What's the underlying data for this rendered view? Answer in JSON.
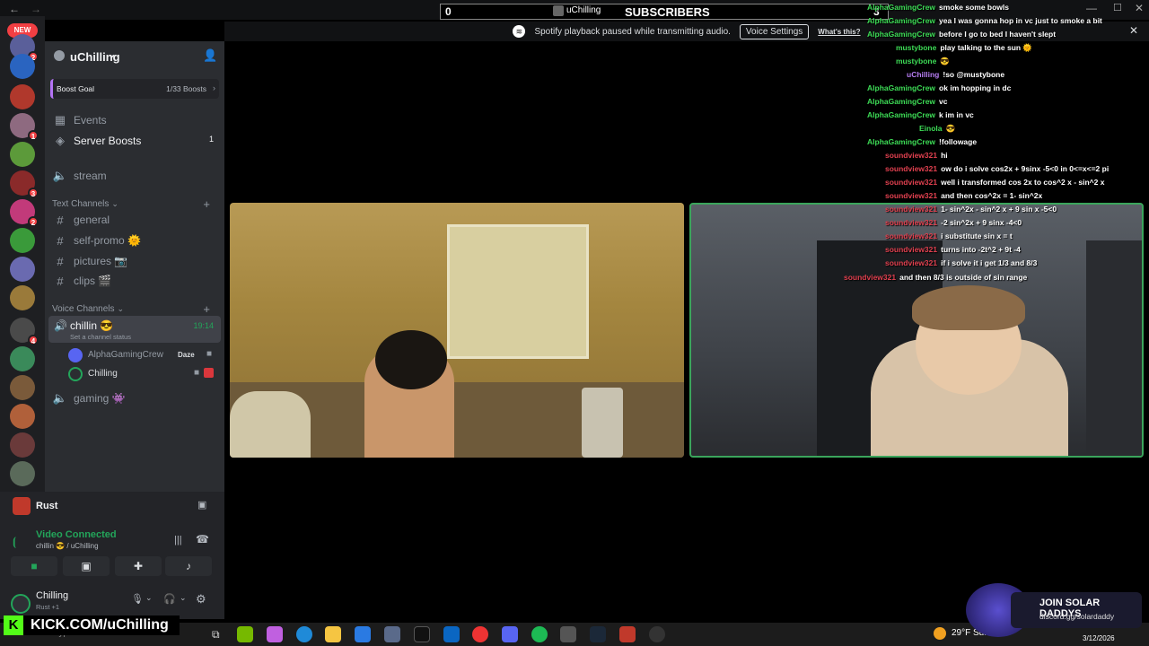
{
  "overlay": {
    "sub_count": "0",
    "sub_user": "uChilling",
    "sub_label": "SUBSCRIBERS",
    "sub_goal": "3"
  },
  "spotify_bar": {
    "message": "Spotify playback paused while transmitting audio.",
    "voice_settings": "Voice Settings",
    "whats_this": "What's this?"
  },
  "rail": {
    "new_label": "NEW",
    "badges": [
      "2",
      "1",
      "3",
      "2",
      "4"
    ]
  },
  "guild": {
    "name": "uChilling",
    "boost_goal_label": "Boost Goal",
    "boost_goal_value": "1/33 Boosts",
    "events": "Events",
    "server_boosts": "Server Boosts",
    "server_boosts_badge": "1",
    "stream": "stream",
    "text_channels_label": "Text Channels",
    "text_channels": [
      "general",
      "self-promo 🌞",
      "pictures 📷",
      "clips 🎬"
    ],
    "voice_channels_label": "Voice Channels",
    "voice_channel": "chillin 😎",
    "voice_timer": "19:14",
    "voice_status": "Set a channel status",
    "voice_members": [
      {
        "name": "AlphaGamingCrew",
        "tag": "Daze"
      },
      {
        "name": "Chilling",
        "tag": ""
      }
    ],
    "gaming_channel": "gaming 👾"
  },
  "activity": {
    "game": "Rust"
  },
  "connection": {
    "status": "Video Connected",
    "location": "chillin 😎 / uChilling"
  },
  "user": {
    "name": "Chilling",
    "sub": "Rust +1"
  },
  "chat": [
    {
      "user": "AlphaGamingCrew",
      "text": "smoke some bowls",
      "color": "#3ddc56"
    },
    {
      "user": "AlphaGamingCrew",
      "text": "yea I was gonna hop in vc just to smoke a bit",
      "color": "#3ddc56"
    },
    {
      "user": "AlphaGamingCrew",
      "text": "before I go to bed I haven't slept",
      "color": "#3ddc56"
    },
    {
      "user": "mustybone",
      "text": "play talking to the sun 🌞",
      "color": "#3ddc56"
    },
    {
      "user": "mustybone",
      "text": "😎",
      "color": "#3ddc56"
    },
    {
      "user": "uChilling",
      "text": "!so @mustybone",
      "color": "#b57cf0"
    },
    {
      "user": "AlphaGamingCrew",
      "text": "ok im hopping in dc",
      "color": "#3ddc56"
    },
    {
      "user": "AlphaGamingCrew",
      "text": "vc",
      "color": "#3ddc56"
    },
    {
      "user": "AlphaGamingCrew",
      "text": "k im in vc",
      "color": "#3ddc56"
    },
    {
      "user": "Einola",
      "text": "😎",
      "color": "#3ddc56"
    },
    {
      "user": "AlphaGamingCrew",
      "text": "!followage",
      "color": "#3ddc56"
    },
    {
      "user": "soundview321",
      "text": "hi",
      "color": "#e0404f"
    },
    {
      "user": "soundview321",
      "text": "ow do i solve cos2x + 9sinx -5<0 in 0<=x<=2 pi",
      "color": "#e0404f"
    },
    {
      "user": "soundview321",
      "text": "well i transformed cos 2x to cos^2 x - sin^2 x",
      "color": "#e0404f"
    },
    {
      "user": "soundview321",
      "text": "and then cos^2x = 1- sin^2x",
      "color": "#e0404f"
    },
    {
      "user": "soundview321",
      "text": "1- sin^2x - sin^2 x + 9 sin x -5<0",
      "color": "#e0404f"
    },
    {
      "user": "soundview321",
      "text": "-2 sin^2x + 9 sinx -4<0",
      "color": "#e0404f"
    },
    {
      "user": "soundview321",
      "text": "i substitute sin x = t",
      "color": "#e0404f"
    },
    {
      "user": "soundview321",
      "text": "turns into -2t^2 + 9t -4",
      "color": "#e0404f"
    },
    {
      "user": "soundview321",
      "text": "if i solve it i get 1/3 and 8/3",
      "color": "#e0404f"
    },
    {
      "user": "soundview321",
      "text": "and then 8/3 is outside of sin range",
      "color": "#e0404f"
    }
  ],
  "promo": {
    "kick": "KICK.COM/uChilling",
    "solar_title": "JOIN SOLAR DADDYS",
    "solar_link": "discord.gg/solardaddy"
  },
  "taskbar": {
    "search_placeholder": "Type here to search",
    "weather": "29°F",
    "weather_suffix": "Sun",
    "date": "3/12/2026"
  }
}
